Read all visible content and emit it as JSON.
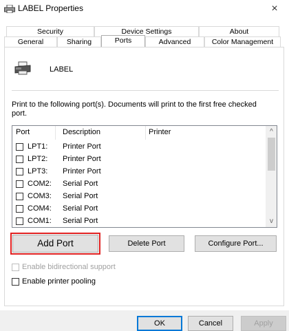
{
  "window": {
    "title": "LABEL Properties",
    "close_glyph": "×",
    "icon": "printer-icon"
  },
  "tabs": {
    "back_row": [
      {
        "label": "Security"
      },
      {
        "label": "Device Settings"
      },
      {
        "label": "About"
      }
    ],
    "front_row": [
      {
        "label": "General"
      },
      {
        "label": "Sharing"
      },
      {
        "label": "Ports",
        "selected": true
      },
      {
        "label": "Advanced"
      },
      {
        "label": "Color Management"
      }
    ]
  },
  "printer": {
    "name": "LABEL",
    "icon": "printer-icon"
  },
  "instructions": "Print to the following port(s). Documents will print to the first free checked port.",
  "port_list": {
    "columns": [
      "Port",
      "Description",
      "Printer"
    ],
    "rows": [
      {
        "port": "LPT1:",
        "description": "Printer Port",
        "checked": false
      },
      {
        "port": "LPT2:",
        "description": "Printer Port",
        "checked": false
      },
      {
        "port": "LPT3:",
        "description": "Printer Port",
        "checked": false
      },
      {
        "port": "COM2:",
        "description": "Serial Port",
        "checked": false
      },
      {
        "port": "COM3:",
        "description": "Serial Port",
        "checked": false
      },
      {
        "port": "COM4:",
        "description": "Serial Port",
        "checked": false
      },
      {
        "port": "COM1:",
        "description": "Serial Port",
        "checked": false
      }
    ],
    "scroll_up_glyph": "^",
    "scroll_down_glyph": "v"
  },
  "port_buttons": {
    "add": "Add Port",
    "delete": "Delete Port",
    "configure": "Configure Port..."
  },
  "options": {
    "bidirectional": {
      "label": "Enable bidirectional support",
      "checked": false,
      "enabled": false
    },
    "pooling": {
      "label": "Enable printer pooling",
      "checked": false,
      "enabled": true
    }
  },
  "dialog_buttons": {
    "ok": "OK",
    "cancel": "Cancel",
    "apply": "Apply"
  },
  "colors": {
    "highlight": "#e02020",
    "default_button_border": "#0078d7"
  }
}
